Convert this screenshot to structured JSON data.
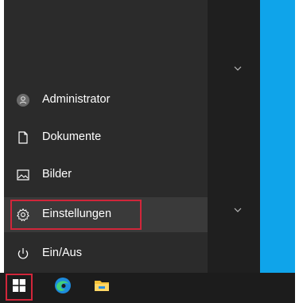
{
  "start_menu": {
    "items": [
      {
        "label": "Administrator",
        "icon": "user-icon"
      },
      {
        "label": "Dokumente",
        "icon": "document-icon"
      },
      {
        "label": "Bilder",
        "icon": "pictures-icon"
      },
      {
        "label": "Einstellungen",
        "icon": "settings-gear-icon"
      },
      {
        "label": "Ein/Aus",
        "icon": "power-icon"
      }
    ],
    "selected_item": "Einstellungen",
    "expand_chevron_icon": "chevron-down-icon"
  },
  "taskbar": {
    "items": [
      {
        "icon": "windows-start-icon"
      },
      {
        "icon": "edge-browser-icon"
      },
      {
        "icon": "file-explorer-icon"
      }
    ]
  },
  "colors": {
    "menu_background": "#2b2b2b",
    "menu_selected": "#3a3a3a",
    "desktop_accent": "#0fa4ea",
    "annotation_red": "#d1263a",
    "taskbar_background": "#1c1c1c"
  }
}
